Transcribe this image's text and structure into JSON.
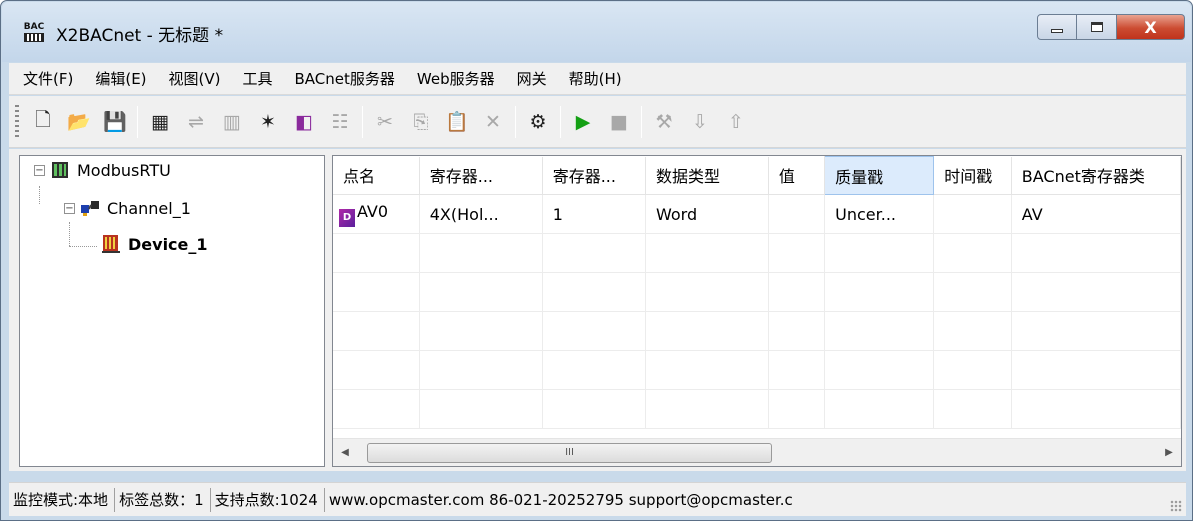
{
  "window": {
    "title": "X2BACnet - 无标题 *",
    "icon_label": "BAC",
    "close_glyph": "X"
  },
  "menu": [
    "文件(F)",
    "编辑(E)",
    "视图(V)",
    "工具",
    "BACnet服务器",
    "Web服务器",
    "网关",
    "帮助(H)"
  ],
  "toolbar": {
    "new_icon": "🗋",
    "open_icon": "📂",
    "save_icon": "💾",
    "add_server_icon": "▦",
    "add_channel_icon": "⇌",
    "add_device_icon": "▥",
    "new_tag_icon": "✶",
    "add_tag_icon": "◧",
    "properties_icon": "☷",
    "cut_icon": "✂",
    "copy_icon": "⎘",
    "paste_icon": "📋",
    "delete_icon": "✕",
    "monitor_icon": "⚙",
    "run_icon": "▶",
    "stop_icon": "■",
    "tools_icon": "⚒",
    "load_icon": "⇩",
    "upload_icon": "⇧"
  },
  "tree": {
    "root": "ModbusRTU",
    "channel": "Channel_1",
    "device": "Device_1",
    "collapse_glyph": "−"
  },
  "table": {
    "columns": [
      "点名",
      "寄存器...",
      "寄存器...",
      "数据类型",
      "值",
      "质量戳",
      "时间戳",
      "BACnet寄存器类"
    ],
    "rows": [
      {
        "icon_label": "D",
        "name": "AV0",
        "register": "4X(Hol...",
        "address": "1",
        "type": "Word",
        "value": "",
        "quality": "Uncer...",
        "timestamp": "",
        "bacnet": "AV"
      }
    ],
    "scroll_left": "◀",
    "scroll_right": "▶",
    "thumb_grip": "III"
  },
  "status": {
    "mode": "监控模式:本地",
    "tag_count": "标签总数：1",
    "support": "支持点数:1024",
    "contact": "www.opcmaster.com 86-021-20252795 support@opcmaster.c"
  }
}
